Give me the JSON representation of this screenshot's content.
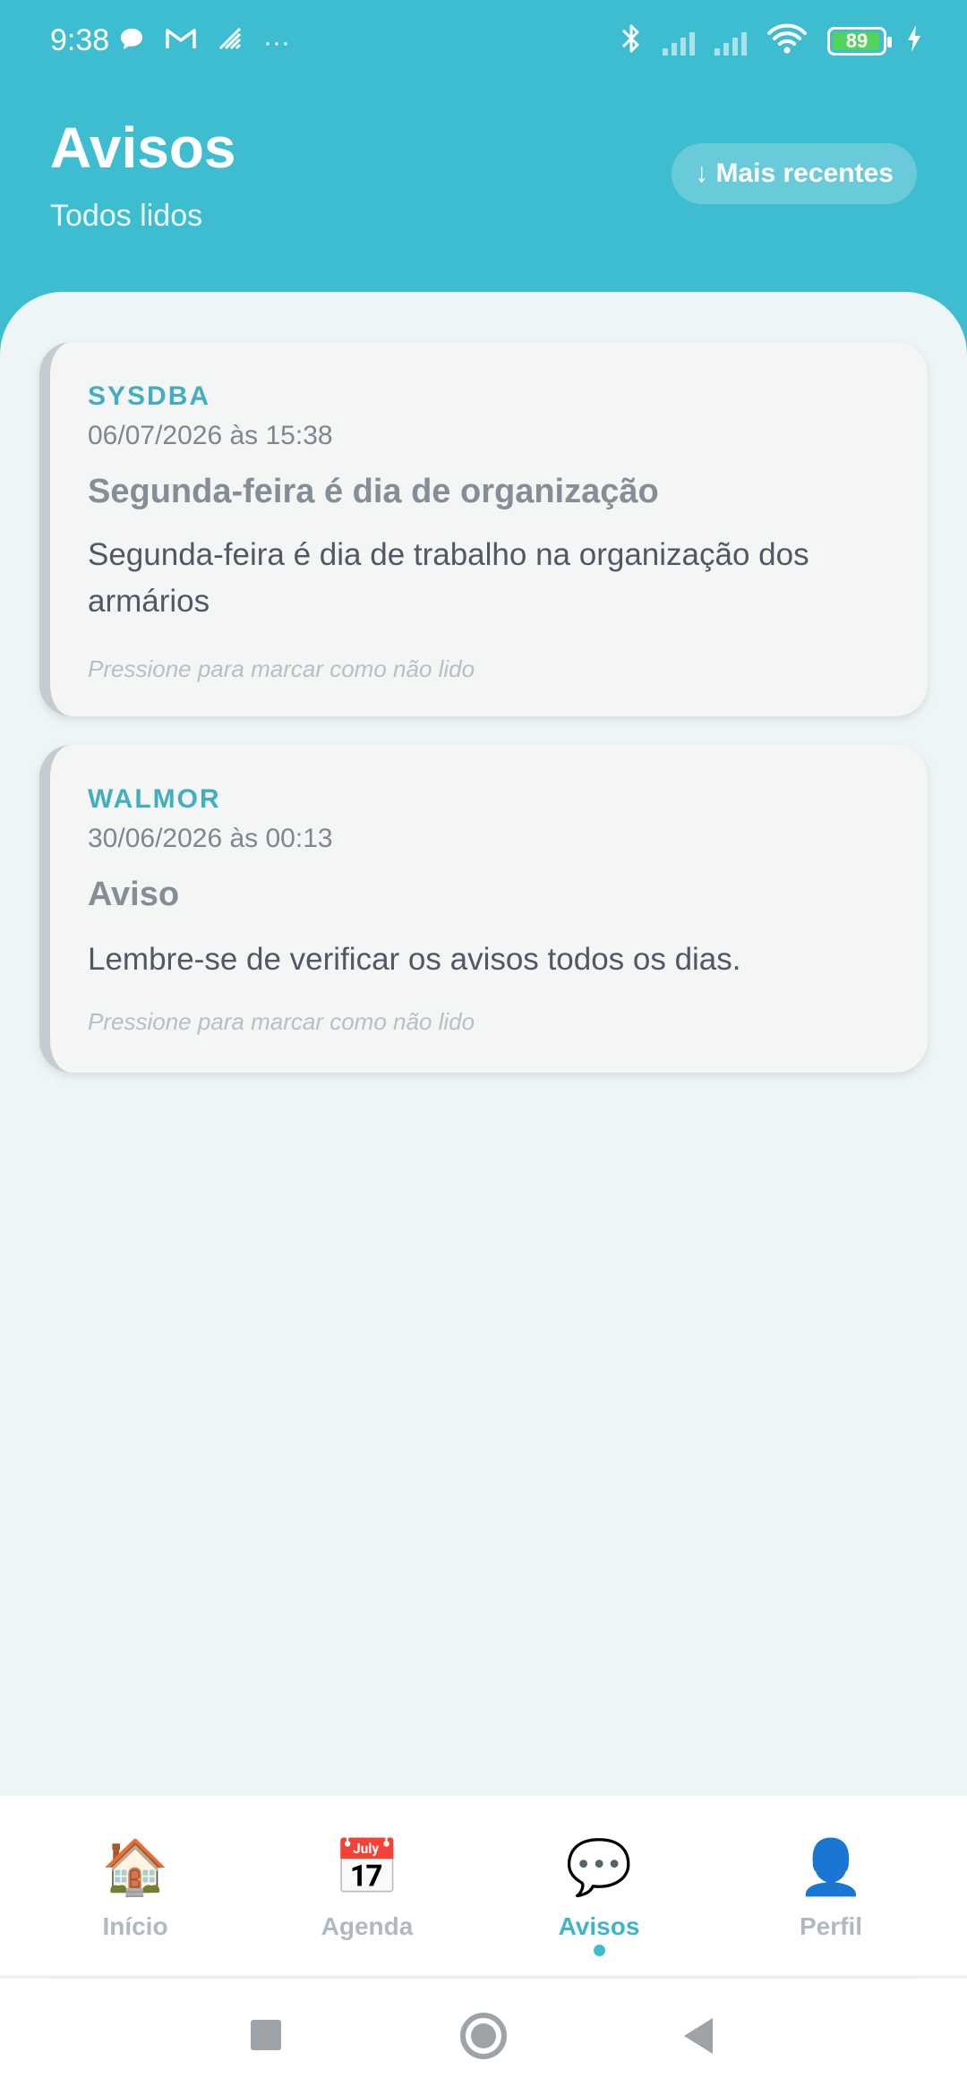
{
  "status_bar": {
    "time": "9:38",
    "left_icons": [
      "chat-icon",
      "gmail-icon",
      "signal-app-icon",
      "more-dots-icon"
    ],
    "right_icons": [
      "bluetooth-icon",
      "signal-x-icon",
      "signal-x-icon",
      "wifi-icon",
      "battery-icon",
      "charging-icon"
    ],
    "battery_level": "89",
    "more_dots": "···"
  },
  "header": {
    "title": "Avisos",
    "subtitle": "Todos lidos",
    "sort_button_label": "↓ Mais recentes"
  },
  "notices": [
    {
      "author": "SYSDBA",
      "date": "06/07/2026 às 15:38",
      "title": "Segunda-feira é dia de organização",
      "body": "Segunda-feira é dia de trabalho na organização dos armários",
      "hint": "Pressione para marcar como não lido"
    },
    {
      "author": "WALMOR",
      "date": "30/06/2026 às 00:13",
      "title": "Aviso",
      "body": "Lembre-se de verificar os avisos todos os dias.",
      "hint": "Pressione para marcar como não lido"
    }
  ],
  "bottom_nav": {
    "items": [
      {
        "label": "Início",
        "icon": "house-icon",
        "glyph": "🏠"
      },
      {
        "label": "Agenda",
        "icon": "calendar-icon",
        "glyph": "📅"
      },
      {
        "label": "Avisos",
        "icon": "speech-bubble-icon",
        "glyph": "💬",
        "active": true
      },
      {
        "label": "Perfil",
        "icon": "user-silhouette-icon",
        "glyph": "👤"
      }
    ]
  },
  "colors": {
    "accent": "#3fbdd0",
    "author_text": "#43aebf",
    "card_background": "#f4f6f6",
    "content_background": "#eef5f7"
  }
}
